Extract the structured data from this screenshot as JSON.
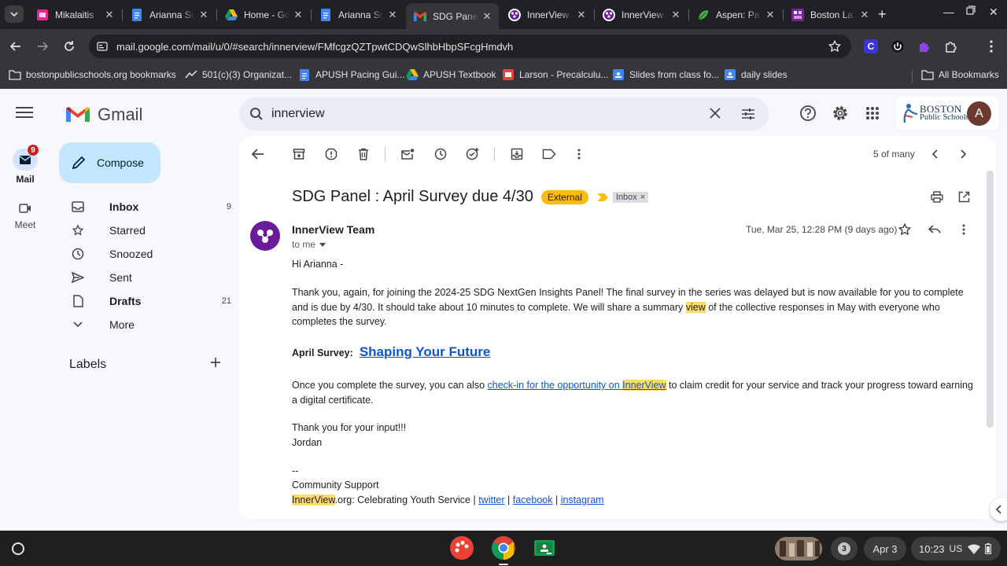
{
  "browser": {
    "tabs": [
      {
        "title": "Mikalaitis",
        "icon": "sheets-pink-icon",
        "color": "#e52592"
      },
      {
        "title": "Arianna Su",
        "icon": "docs-icon",
        "color": "#4285f4"
      },
      {
        "title": "Home - Go",
        "icon": "drive-icon",
        "color": "#fbbc04"
      },
      {
        "title": "Arianna Su",
        "icon": "docs-icon",
        "color": "#4285f4"
      },
      {
        "title": "SDG Panel",
        "icon": "gmail-icon",
        "color": "#ea4335",
        "active": true
      },
      {
        "title": "InnerView",
        "icon": "innerview-icon",
        "color": "#6a1b9a"
      },
      {
        "title": "InnerView",
        "icon": "innerview-icon",
        "color": "#6a1b9a"
      },
      {
        "title": "Aspen: Pa",
        "icon": "aspen-leaf-icon",
        "color": "#4caf50"
      },
      {
        "title": "Boston La",
        "icon": "boston-latin-icon",
        "color": "#7b1fa2"
      }
    ],
    "url": "mail.google.com/mail/u/0/#search/innerview/FMfcgzQZTpwtCDQwSlhbHbpSFcgHmdvh",
    "bookmarks": [
      "bostonpublicschools.org bookmarks",
      "501(c)(3) Organizat...",
      "APUSH Pacing Gui...",
      "APUSH Textbook",
      "Larson - Precalculu...",
      "Slides from class fo...",
      "daily slides"
    ],
    "all_bookmarks": "All Bookmarks",
    "ext_c": "C"
  },
  "gmail": {
    "logo_text": "Gmail",
    "rail": {
      "mail_label": "Mail",
      "mail_badge": "9",
      "meet_label": "Meet"
    },
    "compose_label": "Compose",
    "nav": [
      {
        "label": "Inbox",
        "count": "9",
        "bold": true,
        "icon": "inbox-icon"
      },
      {
        "label": "Starred",
        "count": "",
        "bold": false,
        "icon": "star-icon"
      },
      {
        "label": "Snoozed",
        "count": "",
        "bold": false,
        "icon": "clock-icon"
      },
      {
        "label": "Sent",
        "count": "",
        "bold": false,
        "icon": "send-icon"
      },
      {
        "label": "Drafts",
        "count": "21",
        "bold": true,
        "icon": "draft-icon"
      },
      {
        "label": "More",
        "count": "",
        "bold": false,
        "icon": "chevron-down-icon"
      }
    ],
    "labels_heading": "Labels",
    "search_value": "innerview",
    "account_initial": "A",
    "org_logo": {
      "line1": "BOSTON",
      "line2": "Public Schools"
    },
    "pagination": "5 of many",
    "email": {
      "subject": "SDG Panel : April Survey due 4/30",
      "external_badge": "External",
      "inbox_chip": "Inbox",
      "inbox_chip_close": "×",
      "sender": "InnerView Team",
      "to": "to me",
      "date": "Tue, Mar 25, 12:28 PM (9 days ago)",
      "greeting": "Hi Arianna -",
      "para1_before": "Thank you, again, for joining the 2024-25 SDG NextGen Insights Panel! The final survey in the series was delayed but is now available for you to complete and is due by 4/30. It should take about 10 minutes to complete. We will share a summary ",
      "para1_highlight": "view",
      "para1_after": " of the collective responses in May with everyone who completes the survey.",
      "survey_label": "April Survey:",
      "survey_link": "Shaping Your Future",
      "para3_before": "Once you complete the survey, you can also ",
      "para3_link1": "check-in for the opportunity on ",
      "para3_link_hl": "InnerView",
      "para3_after": " to claim credit for your service and track your progress toward earning a digital certificate.",
      "thanks": "Thank you for your input!!!",
      "signoff": "Jordan",
      "dashes": "--",
      "sig1": "Community Support",
      "sig2_hl": "InnerView",
      "sig2_rest": ".org: Celebrating Youth Service | ",
      "sig_links": [
        "twitter",
        "facebook",
        "instagram"
      ],
      "sig_sep": " | "
    }
  },
  "shelf": {
    "notif_count": "3",
    "date": "Apr 3",
    "time": "10:23",
    "locale": "US"
  },
  "colors": {
    "compose_bg": "#c2e7ff",
    "external_badge": "#fbbc04",
    "highlight": "#fddc6c",
    "link": "#1155cc",
    "avatar_bg": "#6d3a2e",
    "sender_avatar_bg": "#6a1b9a"
  }
}
